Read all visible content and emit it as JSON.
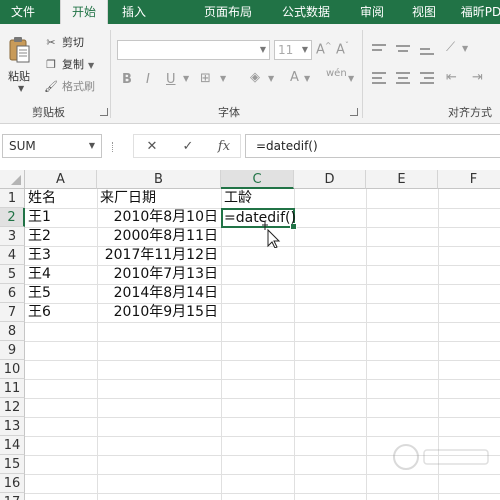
{
  "ribbon": {
    "tabs": [
      "文件",
      "开始",
      "插入",
      "页面布局",
      "公式",
      "数据",
      "审阅",
      "视图",
      "福昕PD"
    ],
    "active_tab": "开始",
    "clipboard": {
      "paste_label": "粘贴",
      "cut_label": "剪切",
      "copy_label": "复制",
      "format_painter_label": "格式刷",
      "group_label": "剪贴板"
    },
    "font": {
      "font_size": "11",
      "group_label": "字体"
    },
    "alignment": {
      "group_label": "对齐方式"
    }
  },
  "formula_bar": {
    "name_box": "SUM",
    "formula": "=datedif()"
  },
  "sheet": {
    "columns": [
      "A",
      "B",
      "C",
      "D",
      "E",
      "F"
    ],
    "rows": [
      "1",
      "2",
      "3",
      "4",
      "5",
      "6",
      "7",
      "8",
      "9",
      "10",
      "11",
      "12",
      "13",
      "14",
      "15",
      "16",
      "17"
    ],
    "header": {
      "a": "姓名",
      "b": "来厂日期",
      "c": "工龄"
    },
    "records": [
      {
        "name": "王1",
        "date": "2010年8月10日"
      },
      {
        "name": "王2",
        "date": "2000年8月11日"
      },
      {
        "name": "王3",
        "date": "2017年11月12日"
      },
      {
        "name": "王4",
        "date": "2010年7月13日"
      },
      {
        "name": "王5",
        "date": "2014年8月14日"
      },
      {
        "name": "王6",
        "date": "2010年9月15日"
      }
    ],
    "editing_cell_text": "=datedif()",
    "active_column": "C",
    "active_row": "2"
  },
  "colors": {
    "accent": "#217346",
    "ribbon_bg": "#f3f3f3"
  }
}
